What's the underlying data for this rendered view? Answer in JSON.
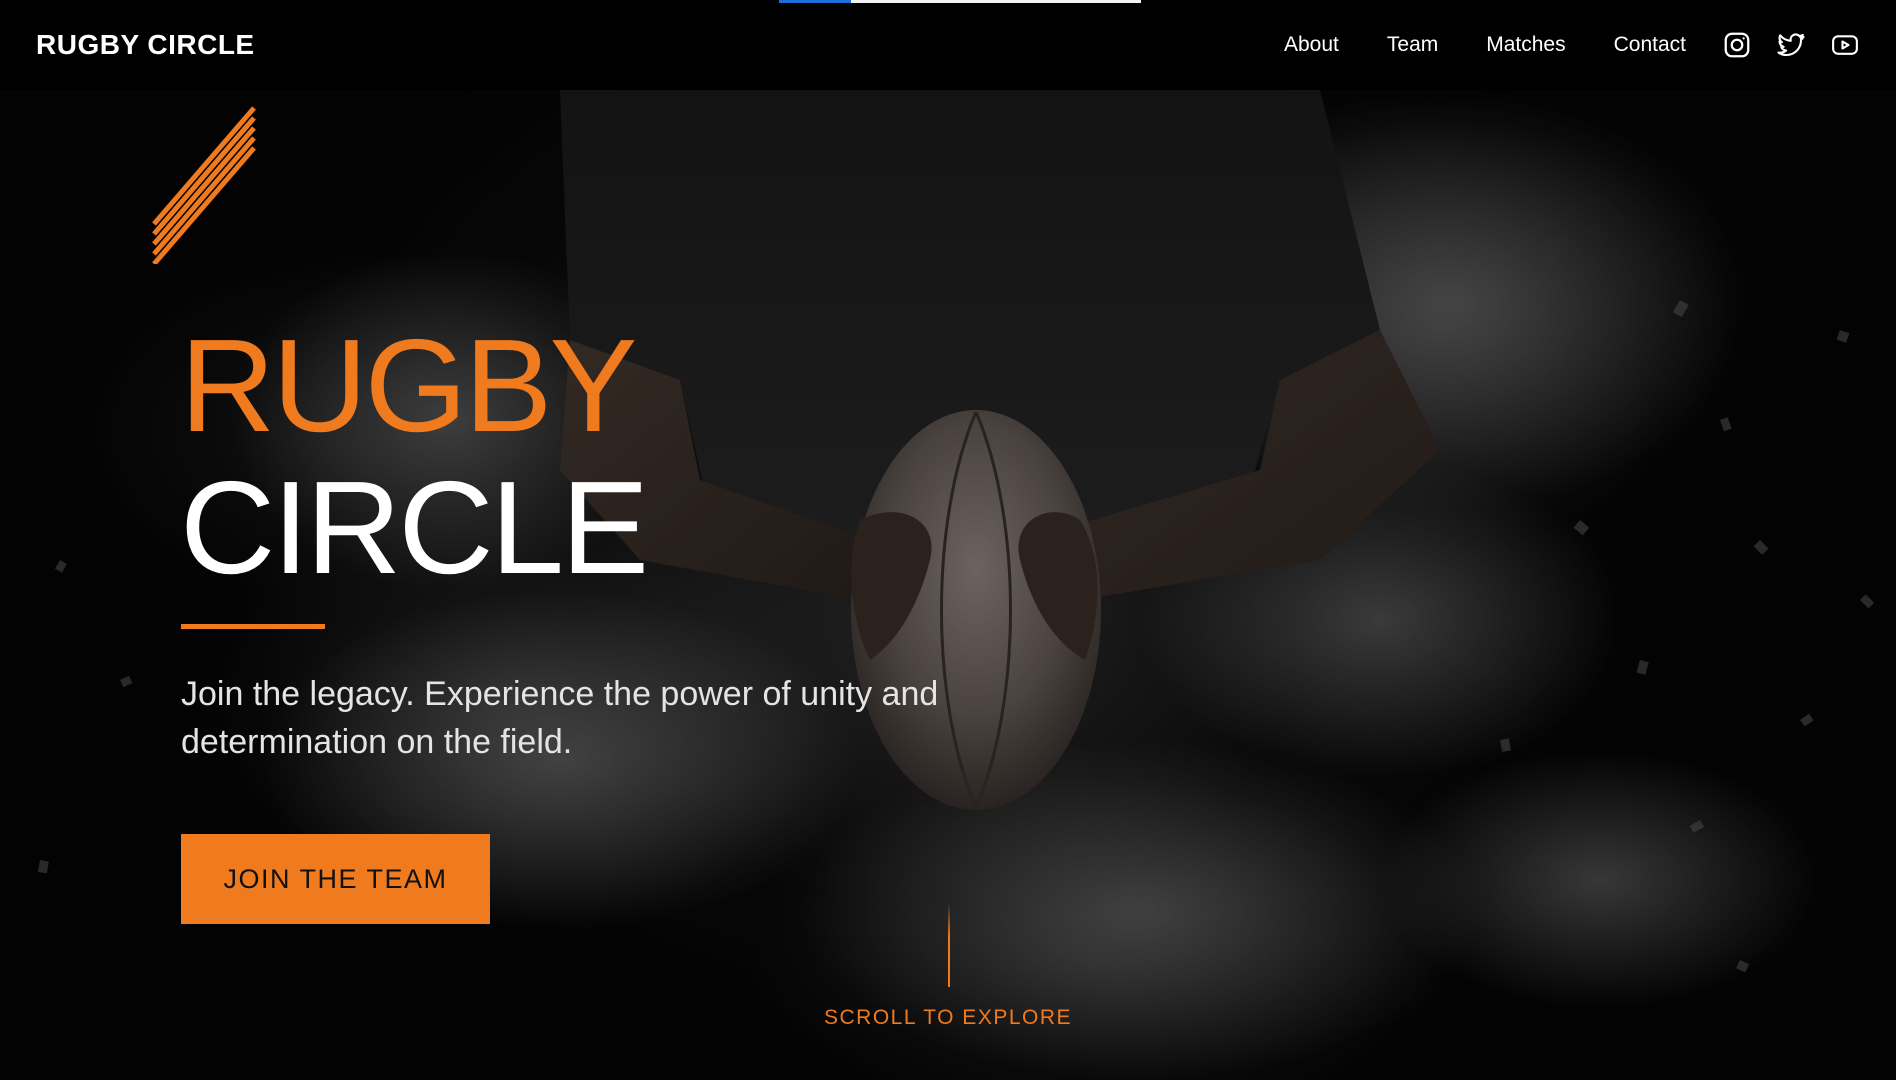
{
  "theme": {
    "accent": "#f07a1e",
    "background": "#000000",
    "text": "#ffffff",
    "progress_color": "#1e6fd9"
  },
  "header": {
    "brand": "RUGBY CIRCLE",
    "nav": [
      {
        "label": "About"
      },
      {
        "label": "Team"
      },
      {
        "label": "Matches"
      },
      {
        "label": "Contact"
      }
    ],
    "social": [
      {
        "icon": "instagram-icon"
      },
      {
        "icon": "twitter-icon"
      },
      {
        "icon": "youtube-icon"
      }
    ]
  },
  "progress": {
    "fraction": 0.2
  },
  "hero": {
    "title_line_1": "RUGBY",
    "title_line_2": "CIRCLE",
    "tagline": "Join the legacy. Experience the power of unity and determination on the field.",
    "cta_label": "JOIN THE TEAM",
    "scroll_label": "SCROLL TO EXPLORE",
    "image_subject": "rugby-player-holding-ball"
  }
}
